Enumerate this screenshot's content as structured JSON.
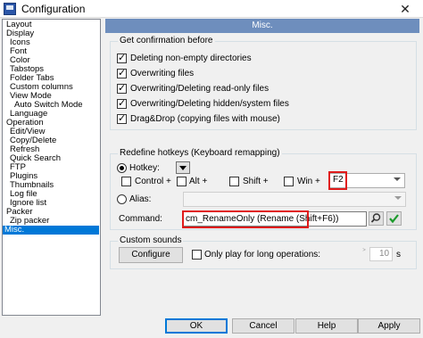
{
  "window": {
    "title": "Configuration",
    "close_glyph": "✕"
  },
  "tree": {
    "items": [
      {
        "label": "Layout",
        "level": 0
      },
      {
        "label": "Display",
        "level": 0
      },
      {
        "label": "Icons",
        "level": 1
      },
      {
        "label": "Font",
        "level": 1
      },
      {
        "label": "Color",
        "level": 1
      },
      {
        "label": "Tabstops",
        "level": 1
      },
      {
        "label": "Folder Tabs",
        "level": 1
      },
      {
        "label": "Custom columns",
        "level": 1
      },
      {
        "label": "View Mode",
        "level": 1
      },
      {
        "label": "Auto Switch Mode",
        "level": 2
      },
      {
        "label": "Language",
        "level": 1
      },
      {
        "label": "Operation",
        "level": 0
      },
      {
        "label": "Edit/View",
        "level": 1
      },
      {
        "label": "Copy/Delete",
        "level": 1
      },
      {
        "label": "Refresh",
        "level": 1
      },
      {
        "label": "Quick Search",
        "level": 1
      },
      {
        "label": "FTP",
        "level": 1
      },
      {
        "label": "Plugins",
        "level": 1
      },
      {
        "label": "Thumbnails",
        "level": 1
      },
      {
        "label": "Log file",
        "level": 1
      },
      {
        "label": "Ignore list",
        "level": 1
      },
      {
        "label": "Packer",
        "level": 0
      },
      {
        "label": "Zip packer",
        "level": 1
      },
      {
        "label": "Misc.",
        "level": 0,
        "selected": true
      }
    ]
  },
  "header": {
    "title": "Misc."
  },
  "confirm": {
    "label": "Get confirmation before",
    "items": [
      {
        "label": "Deleting non-empty directories",
        "checked": true
      },
      {
        "label": "Overwriting files",
        "checked": true
      },
      {
        "label": "Overwriting/Deleting read-only files",
        "checked": true
      },
      {
        "label": "Overwriting/Deleting hidden/system files",
        "checked": true
      },
      {
        "label": "Drag&Drop (copying files with mouse)",
        "checked": true
      }
    ]
  },
  "hotkeys": {
    "label": "Redefine hotkeys (Keyboard remapping)",
    "hotkey_label": "Hotkey:",
    "hotkey_selected": true,
    "control_label": "Control +",
    "alt_label": "Alt +",
    "shift_label": "Shift +",
    "win_label": "Win +",
    "key_value": "F2",
    "alias_label": "Alias:",
    "command_label": "Command:",
    "command_value": "cm_RenameOnly (Rename (Shift+F6))",
    "accent_color": "#e01b1b"
  },
  "sounds": {
    "label": "Custom sounds",
    "configure_label": "Configure",
    "long_ops_label": "Only play for long operations:",
    "seconds_value": "10",
    "seconds_unit": "s",
    "spin_arrows": ">"
  },
  "buttons": {
    "ok": "OK",
    "cancel": "Cancel",
    "help": "Help",
    "apply": "Apply"
  },
  "colors": {
    "selection": "#0078d7",
    "header_bar": "#6e8ebd",
    "highlight_box": "#e01b1b",
    "check_green": "#1a9a2a"
  }
}
